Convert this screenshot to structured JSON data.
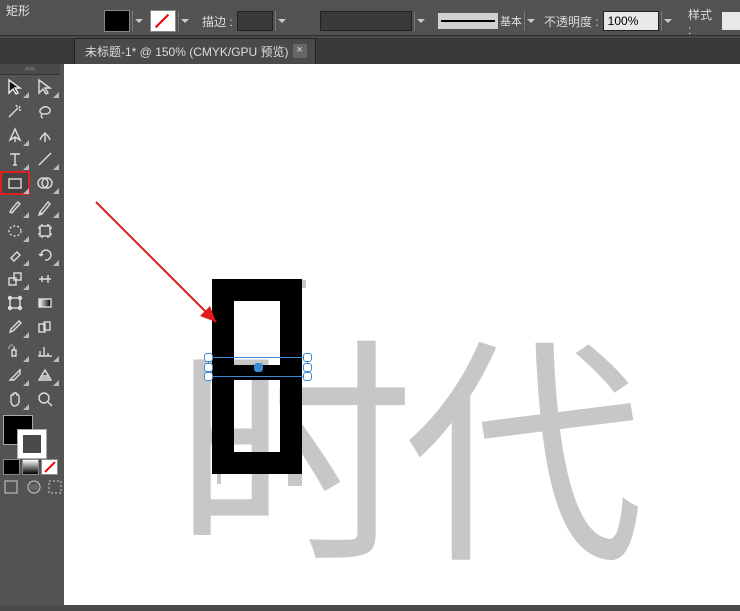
{
  "optbar": {
    "tool_name": "矩形",
    "fill_color": "#000000",
    "stroke_none": true,
    "stroke_label": "描边 :",
    "stroke_weight": "",
    "stroke_style": "基本",
    "opacity_label": "不透明度 :",
    "opacity_value": "100%",
    "style_label": "样式 :"
  },
  "doc_tab": {
    "title": "未标题-1* @ 150% (CMYK/GPU 预览)",
    "close": "×"
  },
  "tools": {
    "selection": "选择工具",
    "direct_select": "直接选择工具",
    "magic_wand": "魔棒",
    "lasso": "套索",
    "pen": "钢笔",
    "curvature": "曲率",
    "type": "文字",
    "line_segment": "线段",
    "rectangle": "矩形",
    "shape_builder": "形状生成器",
    "paintbrush": "画笔",
    "pencil": "铅笔",
    "ellipse": "椭圆",
    "artboard": "画板",
    "eraser": "橡皮擦",
    "rotate": "旋转",
    "scale": "缩放",
    "width": "宽度",
    "free_transform": "自由变换",
    "gradient": "渐变",
    "eyedropper": "吸管",
    "blend": "混合",
    "symbol_sprayer": "符号喷枪器",
    "column_graph": "柱形图",
    "slice": "切片",
    "perspective": "透视网格",
    "mesh": "网格",
    "hand": "抓手",
    "zoom": "缩放"
  },
  "colors": {
    "fill": "#000000",
    "stroke": "none",
    "accent_selection": "#3a8ad6",
    "annotation_arrow": "#e01b1b"
  },
  "canvas": {
    "background_text": "时代",
    "selected_shape": "中间横矩形"
  }
}
